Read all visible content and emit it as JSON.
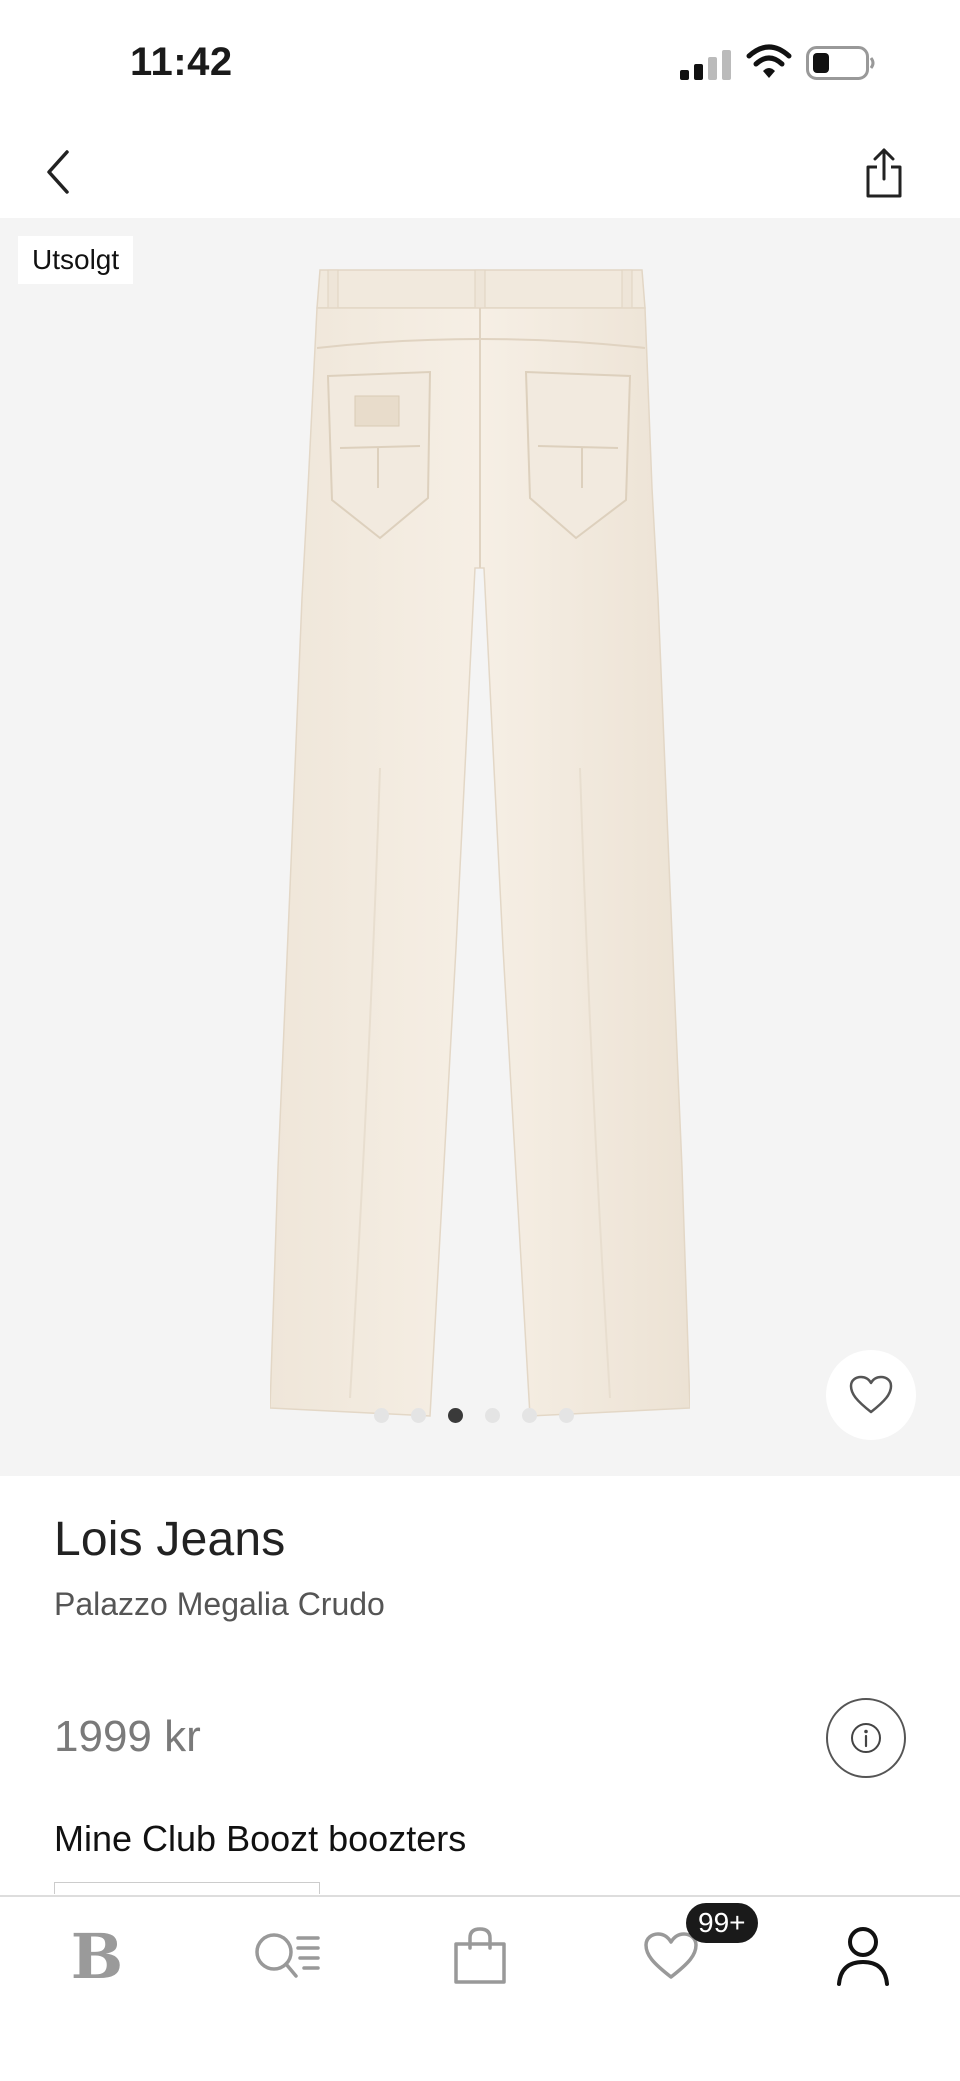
{
  "status_bar": {
    "time": "11:42",
    "icons": [
      "signal-icon",
      "wifi-icon",
      "battery-icon"
    ]
  },
  "nav": {
    "back_icon": "chevron-left-icon",
    "share_icon": "share-icon"
  },
  "gallery": {
    "badge": "Utsolgt",
    "image_count": 6,
    "active_index": 2,
    "favorite_icon": "heart-icon"
  },
  "product": {
    "brand": "Lois Jeans",
    "name": "Palazzo Megalia Crudo",
    "price": "1999 kr",
    "info_icon": "info-icon",
    "club_title": "Mine Club Boozt boozters"
  },
  "tab_bar": {
    "home_logo": "B",
    "favorites_count": "99+",
    "icons": [
      "boozt-logo-icon",
      "search-list-icon",
      "shopping-bag-icon",
      "heart-icon",
      "account-icon"
    ]
  },
  "colors": {
    "gallery_bg": "#f4f4f4",
    "product_cream": "#f3ebdf",
    "active_dot": "#3a3a3a",
    "badge_dark": "#1a1a1a"
  }
}
